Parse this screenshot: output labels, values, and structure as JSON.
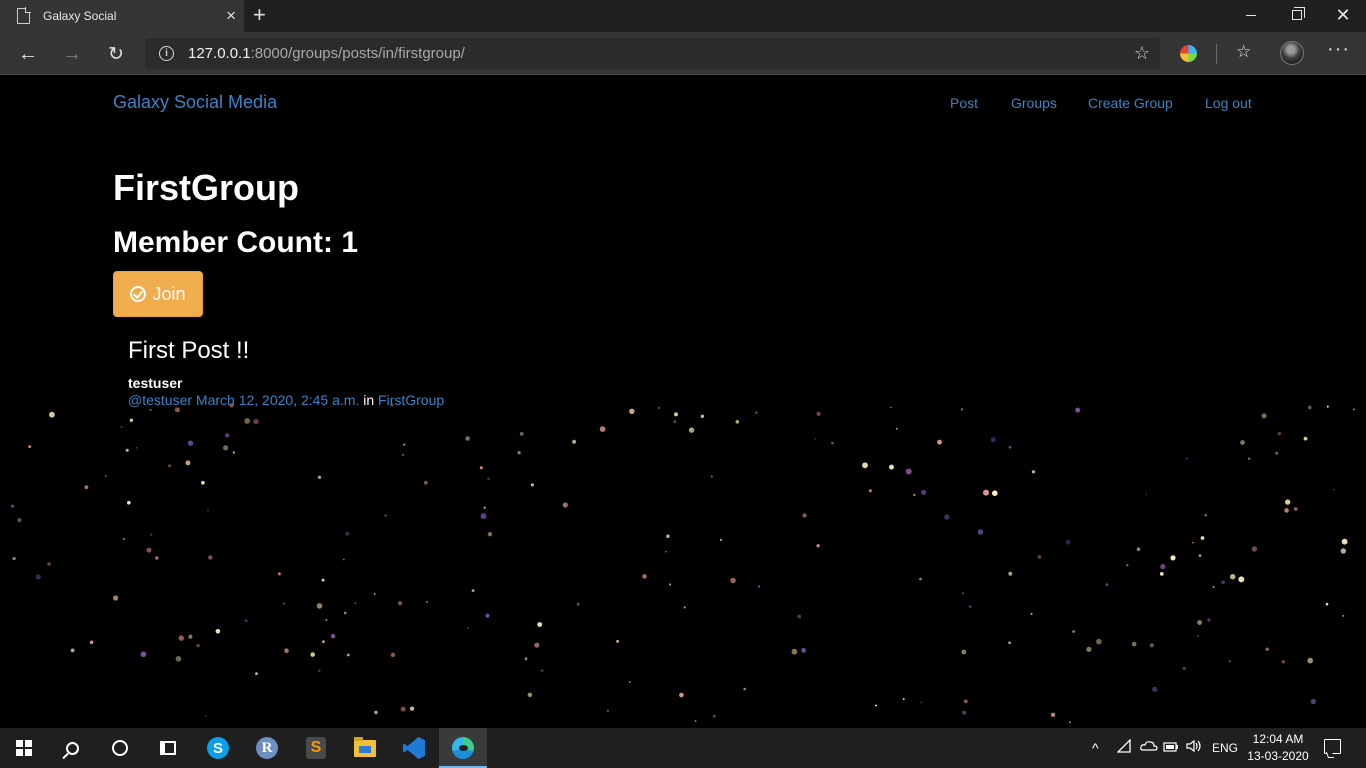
{
  "browser": {
    "tab_title": "Galaxy Social",
    "tab_close": "×",
    "new_tab": "+",
    "url_host": "127.0.0.1",
    "url_rest": ":8000/groups/posts/in/firstgroup/",
    "info_glyph": "i",
    "back_glyph": "←",
    "forward_glyph": "→",
    "reload_glyph": "↻",
    "star_glyph": "☆",
    "favorites_glyph": "☆",
    "more_glyph": "···",
    "close_glyph": "✕"
  },
  "navbar": {
    "brand": "Galaxy Social Media",
    "links": [
      {
        "label": "Post"
      },
      {
        "label": "Groups"
      },
      {
        "label": "Create Group"
      },
      {
        "label": "Log out"
      }
    ]
  },
  "group": {
    "title": "FirstGroup",
    "member_count": "Member Count: 1",
    "join_label": "Join"
  },
  "post": {
    "title": "First Post !!",
    "author": "testuser",
    "handle": "@testuser",
    "timestamp": "March 12, 2020, 2:45 a.m.",
    "in_word": "in",
    "group_link": "FirstGroup"
  },
  "taskbar": {
    "skype_letter": "S",
    "r_letter": "R",
    "sublime_letter": "S",
    "tray_chevron": "^",
    "language": "ENG",
    "time": "12:04 AM",
    "date": "13-03-2020"
  },
  "colors": {
    "link": "#3b83c4",
    "join_button": "#f0ad4e",
    "background": "#000000"
  }
}
